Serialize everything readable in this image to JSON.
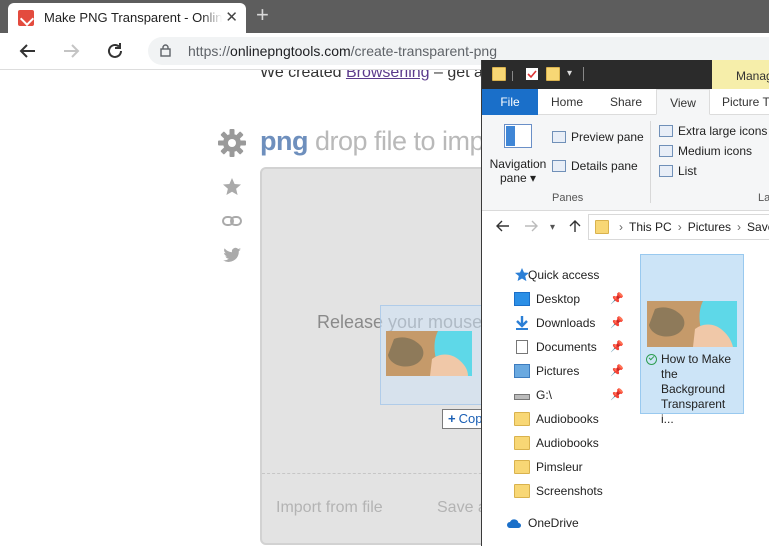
{
  "browser": {
    "tab_title": "Make PNG Transparent - Online PNG Tools",
    "tab_close": "✕",
    "new_tab": "+",
    "url_scheme": "https://",
    "url_host": "onlinepngtools.com",
    "url_path": "/create-transparent-png"
  },
  "page": {
    "promo_prefix": "We created ",
    "promo_link": "Browserling",
    "promo_suffix": " – get a",
    "headline_brand": "png",
    "headline_text": " drop file to import",
    "release_text": "Release your mouse",
    "import_button": "Import from file",
    "save_button": "Save as"
  },
  "drag": {
    "copy_label": "Copy",
    "copy_plus": "+"
  },
  "explorer": {
    "manage_tab": "Manage",
    "ribbon_tabs": [
      "File",
      "Home",
      "Share",
      "View",
      "Picture Tools"
    ],
    "navigation_pane_label": "Navigation pane ▾",
    "preview_pane": "Preview pane",
    "details_pane": "Details pane",
    "panes_group": "Panes",
    "layout_items": [
      "Extra large icons",
      "Medium icons",
      "List"
    ],
    "layout_group": "Layout",
    "breadcrumbs": [
      "This PC",
      "Pictures",
      "Saved Pictures"
    ],
    "nav_tree": [
      {
        "label": "Quick access",
        "pinned": false
      },
      {
        "label": "Desktop",
        "pinned": true
      },
      {
        "label": "Downloads",
        "pinned": true
      },
      {
        "label": "Documents",
        "pinned": true
      },
      {
        "label": "Pictures",
        "pinned": true
      },
      {
        "label": "G:\\",
        "pinned": true
      },
      {
        "label": "Audiobooks",
        "pinned": false
      },
      {
        "label": "Audiobooks",
        "pinned": false
      },
      {
        "label": "Pimsleur",
        "pinned": false
      },
      {
        "label": "Screenshots",
        "pinned": false
      },
      {
        "label": "OneDrive",
        "pinned": false
      }
    ],
    "pin_glyph": "📌",
    "file_name": "How to Make the Background Transparent i..."
  },
  "colors": {
    "accent_blue": "#1a6fc9",
    "selection": "#cce4f7",
    "manage_tab": "#f6eeaa"
  }
}
